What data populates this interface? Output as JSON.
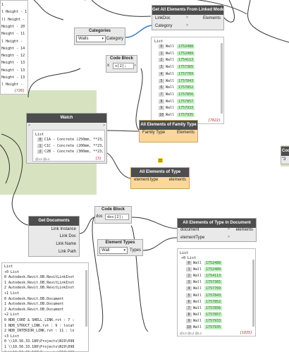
{
  "top_left_panel": {
    "lines": [
      "1",
      "l Height - 1",
      "ll Height -",
      "Height - 20",
      "Height - 11",
      "l Height -",
      "Height - 14",
      "Height - 12",
      "Height - 13",
      "Height - 13",
      "Height - 13",
      "l Height -"
    ],
    "count": "{720}"
  },
  "linked_model_node": {
    "title": "Get All Elements From Linked Model",
    "inputs": [
      "LinkDoc",
      "Category"
    ],
    "output": "Elements"
  },
  "categories_node": {
    "title": "Categories",
    "selected": "Walls",
    "output": "Category"
  },
  "linked_list": {
    "header": "List",
    "items": [
      {
        "idx": "0",
        "label": "Wall",
        "id": "1752488"
      },
      {
        "idx": "1",
        "label": "Wall",
        "id": "1752489"
      },
      {
        "idx": "2",
        "label": "Wall",
        "id": "1754113"
      },
      {
        "idx": "3",
        "label": "Wall",
        "id": "1757365"
      },
      {
        "idx": "4",
        "label": "Wall",
        "id": "1757769"
      },
      {
        "idx": "5",
        "label": "Wall",
        "id": "1757843"
      },
      {
        "idx": "6",
        "label": "Wall",
        "id": "1757852"
      },
      {
        "idx": "7",
        "label": "Wall",
        "id": "1757856"
      },
      {
        "idx": "8",
        "label": "Wall",
        "id": "1757857"
      },
      {
        "idx": "9",
        "label": "Wall",
        "id": "1757933"
      },
      {
        "idx": "10",
        "label": "Wall",
        "id": "1757935"
      }
    ],
    "count": "{7822}"
  },
  "code_block_1": {
    "title": "Code Block",
    "code": "x[2];"
  },
  "watch_node": {
    "title": "Watch",
    "list_header": "List",
    "items": [
      {
        "idx": "0",
        "text": "C1A - Concrete (250mm, **23, Non"
      },
      {
        "idx": "1",
        "text": "C1C - Concrete (200mm, **23, Non"
      },
      {
        "idx": "2",
        "text": "C2B - Concrete (300mm, **23, Stru"
      }
    ],
    "footer": "@L2 @L1",
    "count": "{3}"
  },
  "family_type_node": {
    "title": "All Elements of Family Type",
    "input": "Family Type",
    "output": "Elements"
  },
  "element_type_node": {
    "title": "All Elements of Type",
    "input": "element:type",
    "output": "elements"
  },
  "get_documents_node": {
    "title": "Get Documents",
    "outputs": [
      "Link Instance",
      "Link Doc",
      "Link Name",
      "Link Path"
    ]
  },
  "code_block_2": {
    "title": "Code Block",
    "input": "doc",
    "code": "doc[2];"
  },
  "type_in_document_node": {
    "title": "All Elements of Type in Document",
    "inputs": [
      "document",
      "elementType"
    ],
    "output": "elements"
  },
  "element_types_node": {
    "title": "Element Types",
    "selected": "Wall",
    "output": "Types"
  },
  "bottom_left_panel": {
    "lines": [
      "List",
      "▾0 List",
      "0  Autodesk.Revit.DB.RevitLinkInst",
      "1  Autodesk.Revit.DB.RevitLinkInst",
      "2  Autodesk.Revit.DB.RevitLinkInst",
      "▾1 List",
      "0  Autodesk.Revit.DB.Document",
      "1  Autodesk.Revit.DB.Document",
      "2  Autodesk.Revit.DB.Document",
      "▾2 List",
      "0  NDB_CORE & SHELL_LINK.rvt : 7 :",
      "1  NDB_STRUCT_LINK.rvt : 9 : locat",
      "2  NDB_INTERIOR_LINK.rvt : 11 : lo",
      "▾3 List",
      "0  \\\\10.56.33.180\\Projects\\N19\\098",
      "1  \\\\10.56.33.180\\Projects\\N19\\098",
      "2  \\\\10.56.33.180\\Projects\\N19\\098"
    ],
    "footer": "@L3 @L2 @L1",
    "count": "{12}"
  },
  "doc_list": {
    "header": "List",
    "subheader": "▾0 List",
    "items": [
      {
        "idx": "0",
        "label": "Wall",
        "id": "1752488"
      },
      {
        "idx": "1",
        "label": "Wall",
        "id": "1752489"
      },
      {
        "idx": "2",
        "label": "Wall",
        "id": "1754113"
      },
      {
        "idx": "3",
        "label": "Wall",
        "id": "1757365"
      },
      {
        "idx": "4",
        "label": "Wall",
        "id": "1757769"
      },
      {
        "idx": "5",
        "label": "Wall",
        "id": "1757843"
      },
      {
        "idx": "6",
        "label": "Wall",
        "id": "1757852"
      },
      {
        "idx": "7",
        "label": "Wall",
        "id": "1757856"
      },
      {
        "idx": "8",
        "label": "Wall",
        "id": "1757857"
      },
      {
        "idx": "9",
        "label": "Wall",
        "id": "1757933"
      },
      {
        "idx": "10",
        "label": "Wall",
        "id": "1757935"
      }
    ],
    "footer": "@L3 @L2 @L1",
    "count": "{1835}"
  },
  "right_edge_node": {
    "title": "Code",
    "code": "\"3"
  },
  "colors": {
    "node_header": "#4d4d4d",
    "node_body": "#e9e9e9",
    "orange_node": "#fbd89a",
    "group_bg": "#d7e3c0",
    "value_chip": "#c7f0c7",
    "wire_blue": "#3b78c2"
  }
}
